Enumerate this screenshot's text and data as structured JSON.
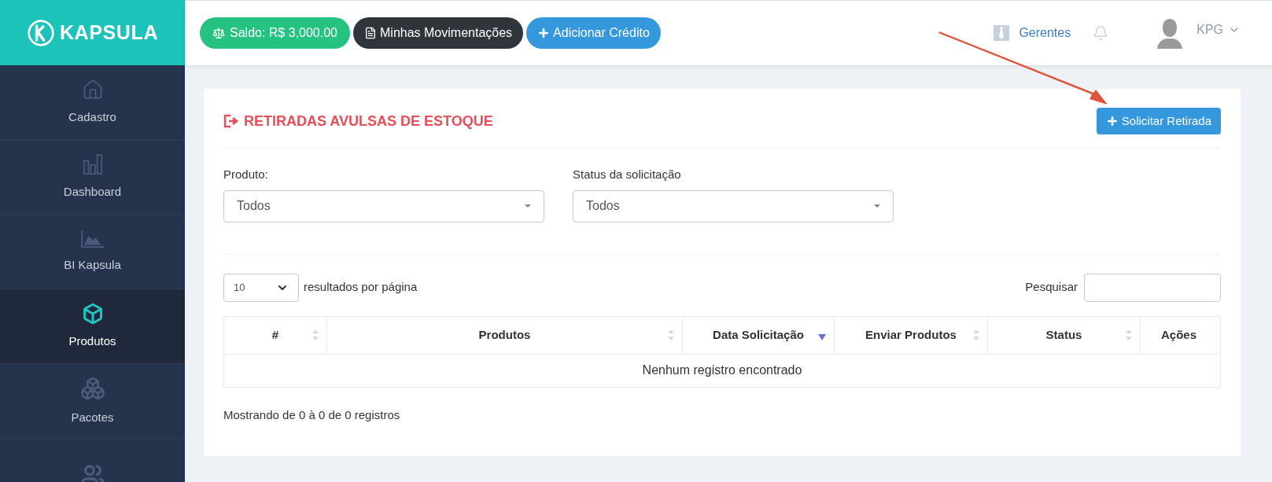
{
  "brand": {
    "name": "KAPSULA"
  },
  "topbar": {
    "balance": "Saldo: R$ 3,000.00",
    "movements": "Minhas Movimentações",
    "add_credit": "Adicionar Crédito",
    "managers": "Gerentes",
    "user": "KPG"
  },
  "sidebar": {
    "items": [
      {
        "label": "Cadastro",
        "selected": false
      },
      {
        "label": "Dashboard",
        "selected": false
      },
      {
        "label": "BI Kapsula",
        "selected": false
      },
      {
        "label": "Produtos",
        "selected": true
      },
      {
        "label": "Pacotes",
        "selected": false
      },
      {
        "selected": false
      }
    ]
  },
  "panel": {
    "title": "RETIRADAS AVULSAS DE ESTOQUE",
    "action": "Solicitar Retirada",
    "filters": [
      {
        "label": "Produto:",
        "value": "Todos"
      },
      {
        "label": "Status da solicitação",
        "value": "Todos"
      }
    ],
    "page_size": "10",
    "page_size_label": "resultados por página",
    "search_label": "Pesquisar",
    "table": {
      "columns": [
        {
          "label": "#",
          "sortable": true,
          "sorted_descending": false
        },
        {
          "label": "Produtos",
          "sortable": true,
          "sorted_descending": false
        },
        {
          "label": "Data Solicitação",
          "sortable": true,
          "sorted_descending": true
        },
        {
          "label": "Enviar Produtos",
          "sortable": true,
          "sorted_descending": false
        },
        {
          "label": "Status",
          "sortable": true,
          "sorted_descending": false
        },
        {
          "label": "Ações",
          "sortable": false
        }
      ],
      "empty": "Nenhum registro encontrado"
    },
    "footer": "Mostrando de 0 à 0 de 0 registros"
  }
}
